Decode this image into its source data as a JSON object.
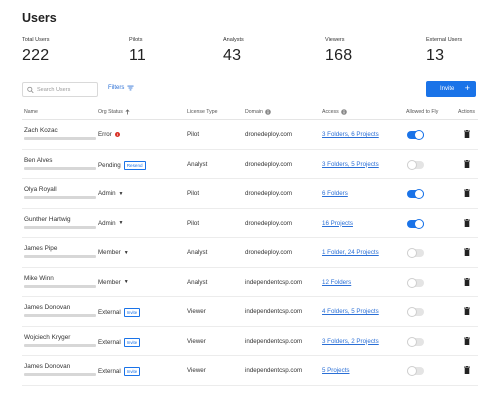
{
  "page": {
    "title": "Users"
  },
  "stats": [
    {
      "label": "Total Users",
      "value": "222"
    },
    {
      "label": "Pilots",
      "value": "11"
    },
    {
      "label": "Analysts",
      "value": "43"
    },
    {
      "label": "Viewers",
      "value": "168"
    },
    {
      "label": "External Users",
      "value": "13"
    }
  ],
  "toolbar": {
    "search_placeholder": "Search Users",
    "filters_label": "Filters",
    "invite_label": "Invite"
  },
  "columns": {
    "name": "Name",
    "org_status": "Org Status",
    "license_type": "License Type",
    "domain": "Domain",
    "access": "Access",
    "allowed_to_fly": "Allowed to Fly",
    "actions": "Actions"
  },
  "rows": [
    {
      "name": "Zach Kozac",
      "status": "Error",
      "license": "Pilot",
      "domain": "dronedeploy.com",
      "access": "3 Folders, 6 Projects",
      "fly": true
    },
    {
      "name": "Ben Alves",
      "status": "Pending",
      "badge": "Resend",
      "license": "Analyst",
      "domain": "dronedeploy.com",
      "access": "3 Folders, 5 Projects",
      "fly": false
    },
    {
      "name": "Olya Royall",
      "status": "Admin",
      "license": "Pilot",
      "domain": "dronedeploy.com",
      "access": "6 Folders",
      "fly": true
    },
    {
      "name": "Gunther Hartwig",
      "status": "Admin",
      "license": "Pilot",
      "domain": "dronedeploy.com",
      "access": "16 Projects",
      "fly": true
    },
    {
      "name": "James Pipe",
      "status": "Member",
      "license": "Analyst",
      "domain": "dronedeploy.com",
      "access": "1 Folder, 24 Projects",
      "fly": false
    },
    {
      "name": "Mike Winn",
      "status": "Member",
      "license": "Analyst",
      "domain": "independentcsp.com",
      "access": "12 Folders",
      "fly": false
    },
    {
      "name": "James Donovan",
      "status": "External",
      "badge": "Invite",
      "license": "Viewer",
      "domain": "independentcsp.com",
      "access": "4 Folders, 5 Projects",
      "fly": false
    },
    {
      "name": "Wojciech Kryger",
      "status": "External",
      "badge": "Invite",
      "license": "Viewer",
      "domain": "independentcsp.com",
      "access": "3 Folders, 2 Projects",
      "fly": false
    },
    {
      "name": "James Donovan",
      "status": "External",
      "badge": "Invite",
      "license": "Viewer",
      "domain": "independentcsp.com",
      "access": "5 Projects",
      "fly": false
    }
  ],
  "colors": {
    "accent": "#1a73e8",
    "error": "#d93025",
    "link": "#2a6fd6"
  }
}
